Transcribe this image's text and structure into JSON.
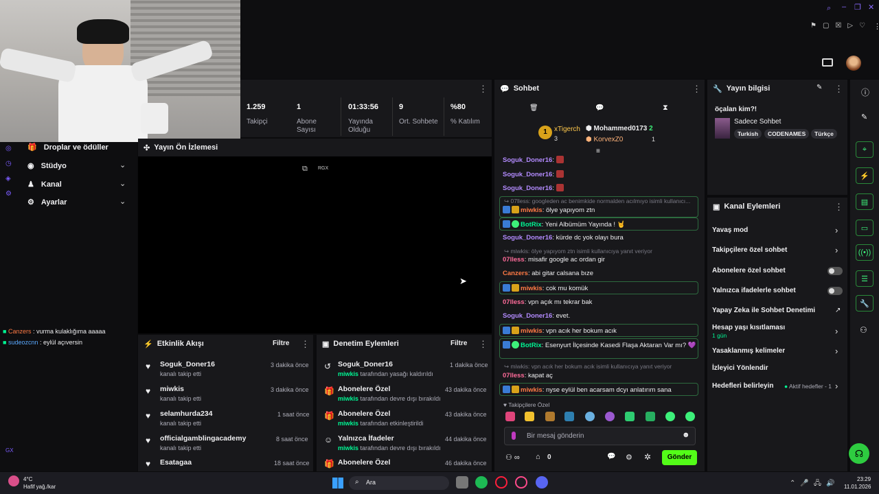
{
  "webcam": {
    "label": "webcam-overlay"
  },
  "top_icons": [
    "search-icon",
    "minimize-icon",
    "restore-icon",
    "close-icon"
  ],
  "stats": [
    {
      "value": "1.259",
      "label": "Takipçi"
    },
    {
      "value": "1",
      "label": "Abone Sayısı"
    },
    {
      "value": "01:33:56",
      "label": "Yayında Olduğu"
    },
    {
      "value": "9",
      "label": "Ort. Sohbete"
    },
    {
      "value": "%80",
      "label": "% Katılım"
    }
  ],
  "nav": {
    "drops": "Droplar ve ödüller",
    "studio": "Stüdyo",
    "channel": "Kanal",
    "settings": "Ayarlar"
  },
  "preview": {
    "title": "Yayın Ön İzlemesi",
    "tag": "RGX"
  },
  "activity": {
    "title": "Etkinlik Akışı",
    "filter": "Filtre",
    "items": [
      {
        "name": "Soguk_Doner16",
        "sub": "kanalı takip etti",
        "time": "3 dakika önce"
      },
      {
        "name": "miwkis",
        "sub": "kanalı takip etti",
        "time": "3 dakika önce"
      },
      {
        "name": "selamhurda234",
        "sub": "kanalı takip etti",
        "time": "1 saat önce"
      },
      {
        "name": "officialgamblingacademy",
        "sub": "kanalı takip etti",
        "time": "8 saat önce"
      },
      {
        "name": "Esatagaa",
        "sub": "",
        "time": "18 saat önce"
      }
    ]
  },
  "mod": {
    "title": "Denetim Eylemleri",
    "filter": "Filtre",
    "items": [
      {
        "name": "Soguk_Doner16",
        "by": "miwkis",
        "sub": " tarafından yasağı kaldırıldı",
        "time": "1 dakika önce"
      },
      {
        "name": "Abonelere Özel",
        "by": "miwkis",
        "sub": " tarafından devre dışı bırakıldı",
        "time": "43 dakika önce"
      },
      {
        "name": "Abonelere Özel",
        "by": "miwkis",
        "sub": " tarafından etkinleştirildi",
        "time": "43 dakika önce"
      },
      {
        "name": "Yalnızca İfadeler",
        "by": "miwkis",
        "sub": " tarafından devre dışı bırakıldı",
        "time": "44 dakika önce"
      },
      {
        "name": "Abonelere Özel",
        "by": "",
        "sub": "",
        "time": "46 dakika önce"
      }
    ]
  },
  "overlay_chat": [
    {
      "user": "Canzers",
      "msg": " : vurma kulaklığıma aaaaa"
    },
    {
      "user": "sudeozcnn",
      "msg": " : eylül açıversin"
    }
  ],
  "chat": {
    "title": "Sohbet",
    "leader1": {
      "name": "xTigerch",
      "count": "3"
    },
    "leader2": {
      "name": "Mohammed0173",
      "count": "2"
    },
    "leader3": {
      "name": "KorvexZ0",
      "count": "1"
    },
    "lines": [
      {
        "user": "Soguk_Doner16",
        "msg": ": "
      },
      {
        "user": "Soguk_Doner16",
        "msg": ": "
      },
      {
        "user": "Soguk_Doner16",
        "msg": ": "
      },
      {
        "reply": "07lless: googleden ac benimkide normalden acılmıyo isimli kullanıcı..."
      },
      {
        "user": "miwkis",
        "msg": ": ölye yapıyom ztn"
      },
      {
        "user": "BotRix",
        "msg": ": Yeni Albümüm Yayında ! 🤘"
      },
      {
        "user": "Soguk_Doner16",
        "msg": ": kürde dc yok olayı bura"
      },
      {
        "reply": "miwkis: ölye yapıyom ztn isimli kullanıcıya yanıt veriyor"
      },
      {
        "user": "07lless",
        "msg": ": misafir google ac ordan gir"
      },
      {
        "user": "Canzers",
        "msg": ": abi gitar calsana bıze"
      },
      {
        "user": "miwkis",
        "msg": ": cok mu komük"
      },
      {
        "user": "07lless",
        "msg": ": vpn açık mı tekrar bak"
      },
      {
        "user": "Soguk_Doner16",
        "msg": ": evet."
      },
      {
        "user": "miwkis",
        "msg": ": vpn acık her bokum acık"
      },
      {
        "user": "BotRix",
        "msg": ": Esenyurt İlçesinde Kasedi Flaşa Aktaran Var mı? 💜"
      },
      {
        "reply": "miwkis: vpn acık her bokum acık isimli kullanıcıya yanıt veriyor"
      },
      {
        "user": "07lless",
        "msg": ": kapat aç"
      },
      {
        "user": "miwkis",
        "msg": ": nyse eylül ben acarsam dcyı anlatırım sana"
      }
    ],
    "emote_label": "Takipçilere Özel",
    "input_placeholder": "Bir mesaj gönderin",
    "send": "Gönder",
    "viewer_count": "0"
  },
  "stream_info": {
    "title": "Yayın bilgisi",
    "stream_title": "öçalan kim?!",
    "category": "Sadece Sohbet",
    "tags": [
      "Turkish",
      "CODENAMES",
      "Türkçe"
    ]
  },
  "channel_actions": {
    "title": "Kanal Eylemleri",
    "slow": "Yavaş mod",
    "followers": "Takipçilere özel sohbet",
    "subs": "Abonelere özel sohbet",
    "emotes": "Yalnızca ifadelerle sohbet",
    "ai": "Yapay Zeka ile Sohbet Denetimi",
    "age": "Hesap yaşı kısıtlaması",
    "age_sub": "1 gün",
    "banned": "Yasaklanmış kelimeler",
    "redirect": "İzleyici Yönlendir",
    "goals": "Hedefleri belirleyin",
    "goals_status": "Aktif hedefler - 1"
  },
  "taskbar": {
    "temp": "4°C",
    "weather": "Hafif yağ./kar",
    "search": "Ara",
    "time": "23:29",
    "date": "11.01.2026",
    "left_tag": "GX"
  },
  "colors": {
    "accent": "#53fc18",
    "bg": "#0b0b0d",
    "panel": "#18181b",
    "purple": "#b38bff"
  }
}
